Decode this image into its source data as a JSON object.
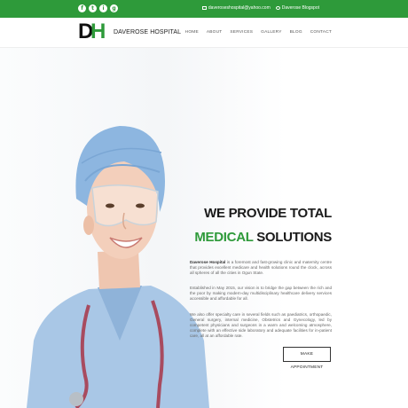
{
  "topbar": {
    "social": [
      "f",
      "t",
      "i",
      "g"
    ],
    "email": "daveroseshospital@yahoo.com",
    "blog": "Daverose Blogspot"
  },
  "header": {
    "logo_left": "D",
    "logo_right": "H",
    "brand": "DAVEROSE HOSPITAL",
    "nav": [
      "HOME",
      "ABOUT",
      "SERVICES",
      "GALLERY",
      "BLOG",
      "CONTACT"
    ]
  },
  "hero": {
    "headline_line1": "WE PROVIDE TOTAL",
    "headline_green": "MEDICAL",
    "headline_rest": " SOLUTIONS",
    "para1_bold": "Daverose Hospital",
    "para1_rest": " is a foremost and fast-growing clinic and maternity centre that provides excellent medicare and health solutions round the clock, across all spheres of all the cities in Ogun State.",
    "para2": "Established in May 2015, our vision is to bridge the gap between the rich and the poor by making modern-day multidisciplinary healthcare delivery services accessible and affordable for all.",
    "para3": "We also offer specialty care in several fields such as paediatrics, orthopaedic, General surgery, internal medicine, Obstetrics and Gynecology, led by competent physicians and surgeons in a warm and welcoming atmosphere, complete with an effective side laboratory and adequate facilities for in-patient care, all at an affordable rate.",
    "button": "MAKE APPOINTMENT"
  },
  "colors": {
    "brand_green": "#2e9a3a",
    "text_dark": "#1a1a1a"
  }
}
